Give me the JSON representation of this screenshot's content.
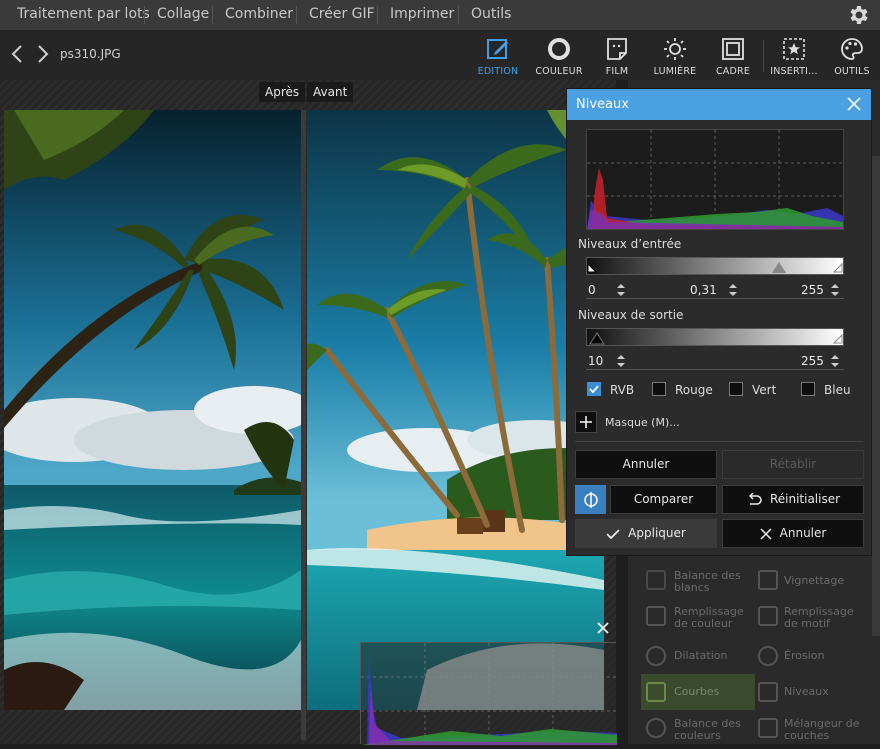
{
  "menubar": {
    "items": [
      "Traitement par lots",
      "Collage",
      "Combiner",
      "Créer GIF",
      "Imprimer",
      "Outils"
    ]
  },
  "toolbar": {
    "filename": "ps310.JPG",
    "tools": [
      {
        "label": "EDITION",
        "icon": "edit-icon",
        "active": true
      },
      {
        "label": "COULEUR",
        "icon": "color-circle-icon",
        "active": false
      },
      {
        "label": "FILM",
        "icon": "film-icon",
        "active": false
      },
      {
        "label": "LUMIÈRE",
        "icon": "light-icon",
        "active": false
      },
      {
        "label": "CADRE",
        "icon": "frame-icon",
        "active": false
      },
      {
        "label": "INSERTI...",
        "icon": "insert-icon",
        "active": false
      },
      {
        "label": "OUTILS",
        "icon": "palette-icon",
        "active": false
      }
    ]
  },
  "canvas": {
    "after_label": "Après",
    "before_label": "Avant"
  },
  "rightpanel": {
    "items": [
      {
        "label": "Balance des blancs",
        "icon": "eyedropper-icon"
      },
      {
        "label": "Vignettage",
        "icon": "vignette-icon"
      },
      {
        "label": "Remplissage de couleur",
        "icon": "fill-color-icon"
      },
      {
        "label": "Remplissage de motif",
        "icon": "fill-pattern-icon"
      },
      {
        "label": "Dilatation",
        "icon": "dilate-icon"
      },
      {
        "label": "Érosion",
        "icon": "erode-icon"
      },
      {
        "label": "Courbes",
        "icon": "curves-icon"
      },
      {
        "label": "Niveaux",
        "icon": "levels-icon"
      },
      {
        "label": "Balance des couleurs",
        "icon": "color-balance-icon"
      },
      {
        "label": "Mélangeur de couches",
        "icon": "channel-mixer-icon"
      }
    ]
  },
  "dialog": {
    "title": "Niveaux",
    "input_levels_label": "Niveaux d’entrée",
    "input_black": "0",
    "input_gamma": "0,31",
    "input_white": "255",
    "output_levels_label": "Niveaux de sortie",
    "output_black": "10",
    "output_white": "255",
    "channels": [
      {
        "label": "RVB",
        "checked": true
      },
      {
        "label": "Rouge",
        "checked": false
      },
      {
        "label": "Vert",
        "checked": false
      },
      {
        "label": "Bleu",
        "checked": false
      }
    ],
    "mask_label": "Masque (M)...",
    "undo_label": "Annuler",
    "redo_label": "Rétablir",
    "compare_label": "Comparer",
    "reset_label": "Réinitialiser",
    "apply_label": "Appliquer",
    "cancel_label": "Annuler",
    "accent": "#4aa0e0"
  }
}
